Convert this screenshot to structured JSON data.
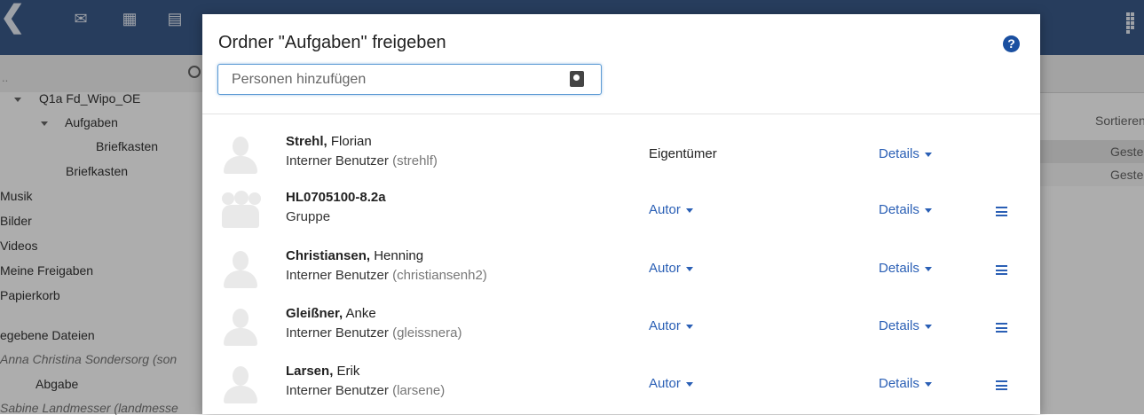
{
  "background": {
    "left_tree": [
      {
        "label": "Q1a Fd_Wipo_OE",
        "style": "normal"
      },
      {
        "label": "Aufgaben",
        "style": "normal"
      },
      {
        "label": "Briefkasten",
        "style": "normal"
      },
      {
        "label": "Briefkasten",
        "style": "normal"
      },
      {
        "label": "Musik",
        "style": "normal"
      },
      {
        "label": "Bilder",
        "style": "normal"
      },
      {
        "label": "Videos",
        "style": "normal"
      },
      {
        "label": "Meine Freigaben",
        "style": "normal"
      },
      {
        "label": "Papierkorb",
        "style": "normal"
      },
      {
        "label": "egebene Dateien",
        "style": "normal"
      },
      {
        "label": "Anna Christina Sondersorg (son",
        "style": "italic"
      },
      {
        "label": "Abgabe",
        "style": "normal"
      },
      {
        "label": "Sabine Landmesser (landmesse",
        "style": "italic"
      }
    ],
    "left_search_placeholder": "..",
    "right_sort_label": "Sortieren",
    "right_rows": [
      "Gestern",
      "Gestern"
    ]
  },
  "dialog": {
    "title": "Ordner \"Aufgaben\" freigeben",
    "help_icon": "question-circle-icon",
    "add_input_placeholder": "Personen hinzufügen",
    "members": [
      {
        "last": "Strehl,",
        "first": "Florian",
        "type": "Interner Benutzer",
        "uid": "(strehlf)",
        "role": "Eigentümer",
        "role_editable": false,
        "details": "Details",
        "has_menu": false,
        "avatar": "person"
      },
      {
        "last": "HL0705100-8.2a",
        "first": "",
        "type": "Gruppe",
        "uid": "",
        "role": "Autor",
        "role_editable": true,
        "details": "Details",
        "has_menu": true,
        "avatar": "group"
      },
      {
        "last": "Christiansen,",
        "first": "Henning",
        "type": "Interner Benutzer",
        "uid": "(christiansenh2)",
        "role": "Autor",
        "role_editable": true,
        "details": "Details",
        "has_menu": true,
        "avatar": "person"
      },
      {
        "last": "Gleißner,",
        "first": "Anke",
        "type": "Interner Benutzer",
        "uid": "(gleissnera)",
        "role": "Autor",
        "role_editable": true,
        "details": "Details",
        "has_menu": true,
        "avatar": "person"
      },
      {
        "last": "Larsen,",
        "first": "Erik",
        "type": "Interner Benutzer",
        "uid": "(larsene)",
        "role": "Autor",
        "role_editable": true,
        "details": "Details",
        "has_menu": true,
        "avatar": "person"
      }
    ]
  },
  "colors": {
    "topbar": "#3a5a8a",
    "link": "#2a5fb5",
    "help": "#1a4fa0"
  }
}
